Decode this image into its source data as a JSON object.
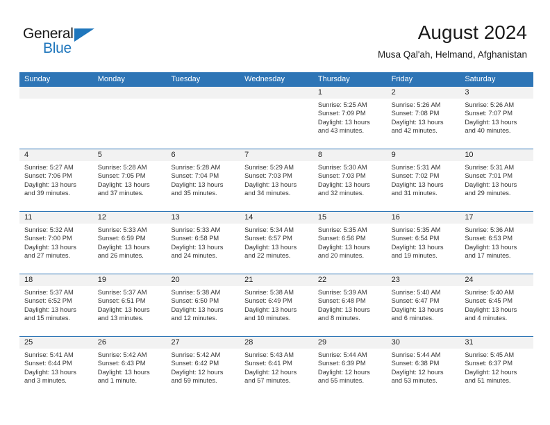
{
  "brand": {
    "name_part1": "General",
    "name_part2": "Blue",
    "logo_icon": "triangle-icon",
    "accent_color": "#1f76bc"
  },
  "header": {
    "title": "August 2024",
    "subtitle": "Musa Qal'ah, Helmand, Afghanistan"
  },
  "colors": {
    "header_blue": "#2e75b6",
    "daynum_band": "#f2f2f2",
    "text": "#333333"
  },
  "weekday_headers": [
    "Sunday",
    "Monday",
    "Tuesday",
    "Wednesday",
    "Thursday",
    "Friday",
    "Saturday"
  ],
  "weeks": [
    {
      "days": [
        {
          "num": "",
          "lines": []
        },
        {
          "num": "",
          "lines": []
        },
        {
          "num": "",
          "lines": []
        },
        {
          "num": "",
          "lines": []
        },
        {
          "num": "1",
          "lines": [
            "Sunrise: 5:25 AM",
            "Sunset: 7:09 PM",
            "Daylight: 13 hours",
            "and 43 minutes."
          ]
        },
        {
          "num": "2",
          "lines": [
            "Sunrise: 5:26 AM",
            "Sunset: 7:08 PM",
            "Daylight: 13 hours",
            "and 42 minutes."
          ]
        },
        {
          "num": "3",
          "lines": [
            "Sunrise: 5:26 AM",
            "Sunset: 7:07 PM",
            "Daylight: 13 hours",
            "and 40 minutes."
          ]
        }
      ]
    },
    {
      "days": [
        {
          "num": "4",
          "lines": [
            "Sunrise: 5:27 AM",
            "Sunset: 7:06 PM",
            "Daylight: 13 hours",
            "and 39 minutes."
          ]
        },
        {
          "num": "5",
          "lines": [
            "Sunrise: 5:28 AM",
            "Sunset: 7:05 PM",
            "Daylight: 13 hours",
            "and 37 minutes."
          ]
        },
        {
          "num": "6",
          "lines": [
            "Sunrise: 5:28 AM",
            "Sunset: 7:04 PM",
            "Daylight: 13 hours",
            "and 35 minutes."
          ]
        },
        {
          "num": "7",
          "lines": [
            "Sunrise: 5:29 AM",
            "Sunset: 7:03 PM",
            "Daylight: 13 hours",
            "and 34 minutes."
          ]
        },
        {
          "num": "8",
          "lines": [
            "Sunrise: 5:30 AM",
            "Sunset: 7:03 PM",
            "Daylight: 13 hours",
            "and 32 minutes."
          ]
        },
        {
          "num": "9",
          "lines": [
            "Sunrise: 5:31 AM",
            "Sunset: 7:02 PM",
            "Daylight: 13 hours",
            "and 31 minutes."
          ]
        },
        {
          "num": "10",
          "lines": [
            "Sunrise: 5:31 AM",
            "Sunset: 7:01 PM",
            "Daylight: 13 hours",
            "and 29 minutes."
          ]
        }
      ]
    },
    {
      "days": [
        {
          "num": "11",
          "lines": [
            "Sunrise: 5:32 AM",
            "Sunset: 7:00 PM",
            "Daylight: 13 hours",
            "and 27 minutes."
          ]
        },
        {
          "num": "12",
          "lines": [
            "Sunrise: 5:33 AM",
            "Sunset: 6:59 PM",
            "Daylight: 13 hours",
            "and 26 minutes."
          ]
        },
        {
          "num": "13",
          "lines": [
            "Sunrise: 5:33 AM",
            "Sunset: 6:58 PM",
            "Daylight: 13 hours",
            "and 24 minutes."
          ]
        },
        {
          "num": "14",
          "lines": [
            "Sunrise: 5:34 AM",
            "Sunset: 6:57 PM",
            "Daylight: 13 hours",
            "and 22 minutes."
          ]
        },
        {
          "num": "15",
          "lines": [
            "Sunrise: 5:35 AM",
            "Sunset: 6:56 PM",
            "Daylight: 13 hours",
            "and 20 minutes."
          ]
        },
        {
          "num": "16",
          "lines": [
            "Sunrise: 5:35 AM",
            "Sunset: 6:54 PM",
            "Daylight: 13 hours",
            "and 19 minutes."
          ]
        },
        {
          "num": "17",
          "lines": [
            "Sunrise: 5:36 AM",
            "Sunset: 6:53 PM",
            "Daylight: 13 hours",
            "and 17 minutes."
          ]
        }
      ]
    },
    {
      "days": [
        {
          "num": "18",
          "lines": [
            "Sunrise: 5:37 AM",
            "Sunset: 6:52 PM",
            "Daylight: 13 hours",
            "and 15 minutes."
          ]
        },
        {
          "num": "19",
          "lines": [
            "Sunrise: 5:37 AM",
            "Sunset: 6:51 PM",
            "Daylight: 13 hours",
            "and 13 minutes."
          ]
        },
        {
          "num": "20",
          "lines": [
            "Sunrise: 5:38 AM",
            "Sunset: 6:50 PM",
            "Daylight: 13 hours",
            "and 12 minutes."
          ]
        },
        {
          "num": "21",
          "lines": [
            "Sunrise: 5:38 AM",
            "Sunset: 6:49 PM",
            "Daylight: 13 hours",
            "and 10 minutes."
          ]
        },
        {
          "num": "22",
          "lines": [
            "Sunrise: 5:39 AM",
            "Sunset: 6:48 PM",
            "Daylight: 13 hours",
            "and 8 minutes."
          ]
        },
        {
          "num": "23",
          "lines": [
            "Sunrise: 5:40 AM",
            "Sunset: 6:47 PM",
            "Daylight: 13 hours",
            "and 6 minutes."
          ]
        },
        {
          "num": "24",
          "lines": [
            "Sunrise: 5:40 AM",
            "Sunset: 6:45 PM",
            "Daylight: 13 hours",
            "and 4 minutes."
          ]
        }
      ]
    },
    {
      "days": [
        {
          "num": "25",
          "lines": [
            "Sunrise: 5:41 AM",
            "Sunset: 6:44 PM",
            "Daylight: 13 hours",
            "and 3 minutes."
          ]
        },
        {
          "num": "26",
          "lines": [
            "Sunrise: 5:42 AM",
            "Sunset: 6:43 PM",
            "Daylight: 13 hours",
            "and 1 minute."
          ]
        },
        {
          "num": "27",
          "lines": [
            "Sunrise: 5:42 AM",
            "Sunset: 6:42 PM",
            "Daylight: 12 hours",
            "and 59 minutes."
          ]
        },
        {
          "num": "28",
          "lines": [
            "Sunrise: 5:43 AM",
            "Sunset: 6:41 PM",
            "Daylight: 12 hours",
            "and 57 minutes."
          ]
        },
        {
          "num": "29",
          "lines": [
            "Sunrise: 5:44 AM",
            "Sunset: 6:39 PM",
            "Daylight: 12 hours",
            "and 55 minutes."
          ]
        },
        {
          "num": "30",
          "lines": [
            "Sunrise: 5:44 AM",
            "Sunset: 6:38 PM",
            "Daylight: 12 hours",
            "and 53 minutes."
          ]
        },
        {
          "num": "31",
          "lines": [
            "Sunrise: 5:45 AM",
            "Sunset: 6:37 PM",
            "Daylight: 12 hours",
            "and 51 minutes."
          ]
        }
      ]
    }
  ]
}
